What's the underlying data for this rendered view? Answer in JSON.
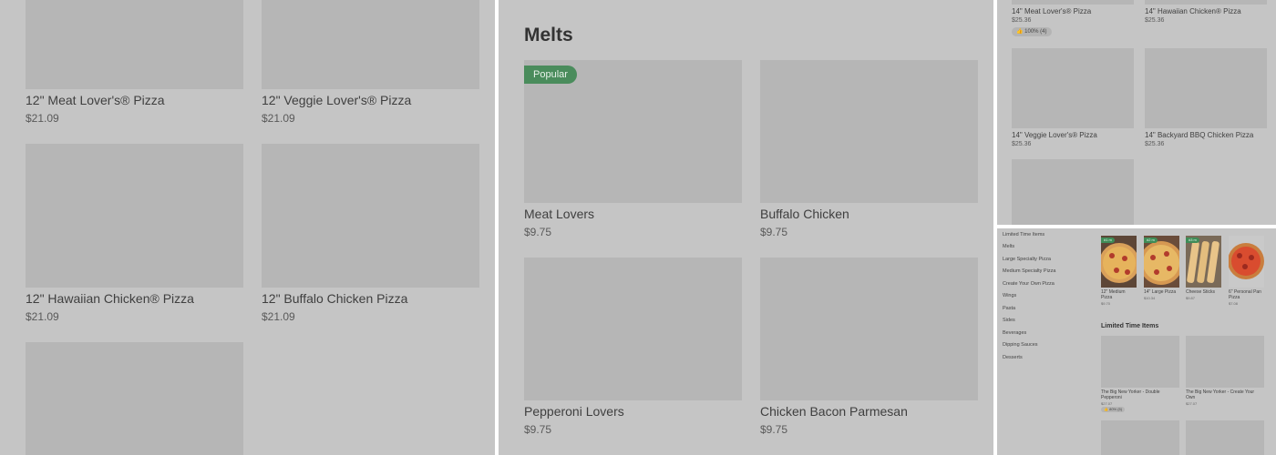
{
  "panel1": {
    "items": [
      {
        "name": "12\" Meat Lover's® Pizza",
        "price": "$21.09"
      },
      {
        "name": "12\" Veggie Lover's® Pizza",
        "price": "$21.09"
      },
      {
        "name": "12\" Hawaiian Chicken® Pizza",
        "price": "$21.09"
      },
      {
        "name": "12\" Buffalo Chicken Pizza",
        "price": "$21.09"
      }
    ]
  },
  "panel2": {
    "section_title": "Melts",
    "badge": "Popular",
    "items": [
      {
        "name": "Meat Lovers",
        "price": "$9.75"
      },
      {
        "name": "Buffalo Chicken",
        "price": "$9.75"
      },
      {
        "name": "Pepperoni Lovers",
        "price": "$9.75"
      },
      {
        "name": "Chicken Bacon Parmesan",
        "price": "$9.75"
      }
    ]
  },
  "panel3": {
    "items": [
      {
        "name": "14\" Meat Lover's® Pizza",
        "price": "$25.36",
        "rating": "100% (4)"
      },
      {
        "name": "14\" Hawaiian Chicken® Pizza",
        "price": "$25.36"
      },
      {
        "name": "14\" Veggie Lover's® Pizza",
        "price": "$25.36"
      },
      {
        "name": "14\" Backyard BBQ Chicken Pizza",
        "price": "$25.36"
      }
    ]
  },
  "panel4": {
    "categories": [
      "Limited Time Items",
      "Melts",
      "Large Specialty Pizza",
      "Medium Specialty Pizza",
      "Create Your Own Pizza",
      "Wings",
      "Pasta",
      "Sides",
      "Beverages",
      "Dipping Sauces",
      "Desserts"
    ],
    "featured": [
      {
        "tag": "#1 m",
        "name": "12\" Medium Pizza",
        "price": "$9.70"
      },
      {
        "tag": "#2 m",
        "name": "14\" Large Pizza",
        "price": "$10.34"
      },
      {
        "tag": "#3 m",
        "name": "Cheese Sticks",
        "price": "$9.87"
      },
      {
        "tag": "",
        "name": "6\" Personal Pan Pizza",
        "price": "$7.08"
      }
    ],
    "section_title": "Limited Time Items",
    "limited": [
      {
        "name": "The Big New Yorker - Double Pepperoni",
        "price": "$27.07",
        "rating": "👍 80% (5)"
      },
      {
        "name": "The Big New Yorker - Create Your Own",
        "price": "$27.07"
      }
    ]
  },
  "colors": {
    "overlay": "#c5c5c5",
    "placeholder": "#b6b6b6",
    "badge": "#4a8c5c"
  }
}
